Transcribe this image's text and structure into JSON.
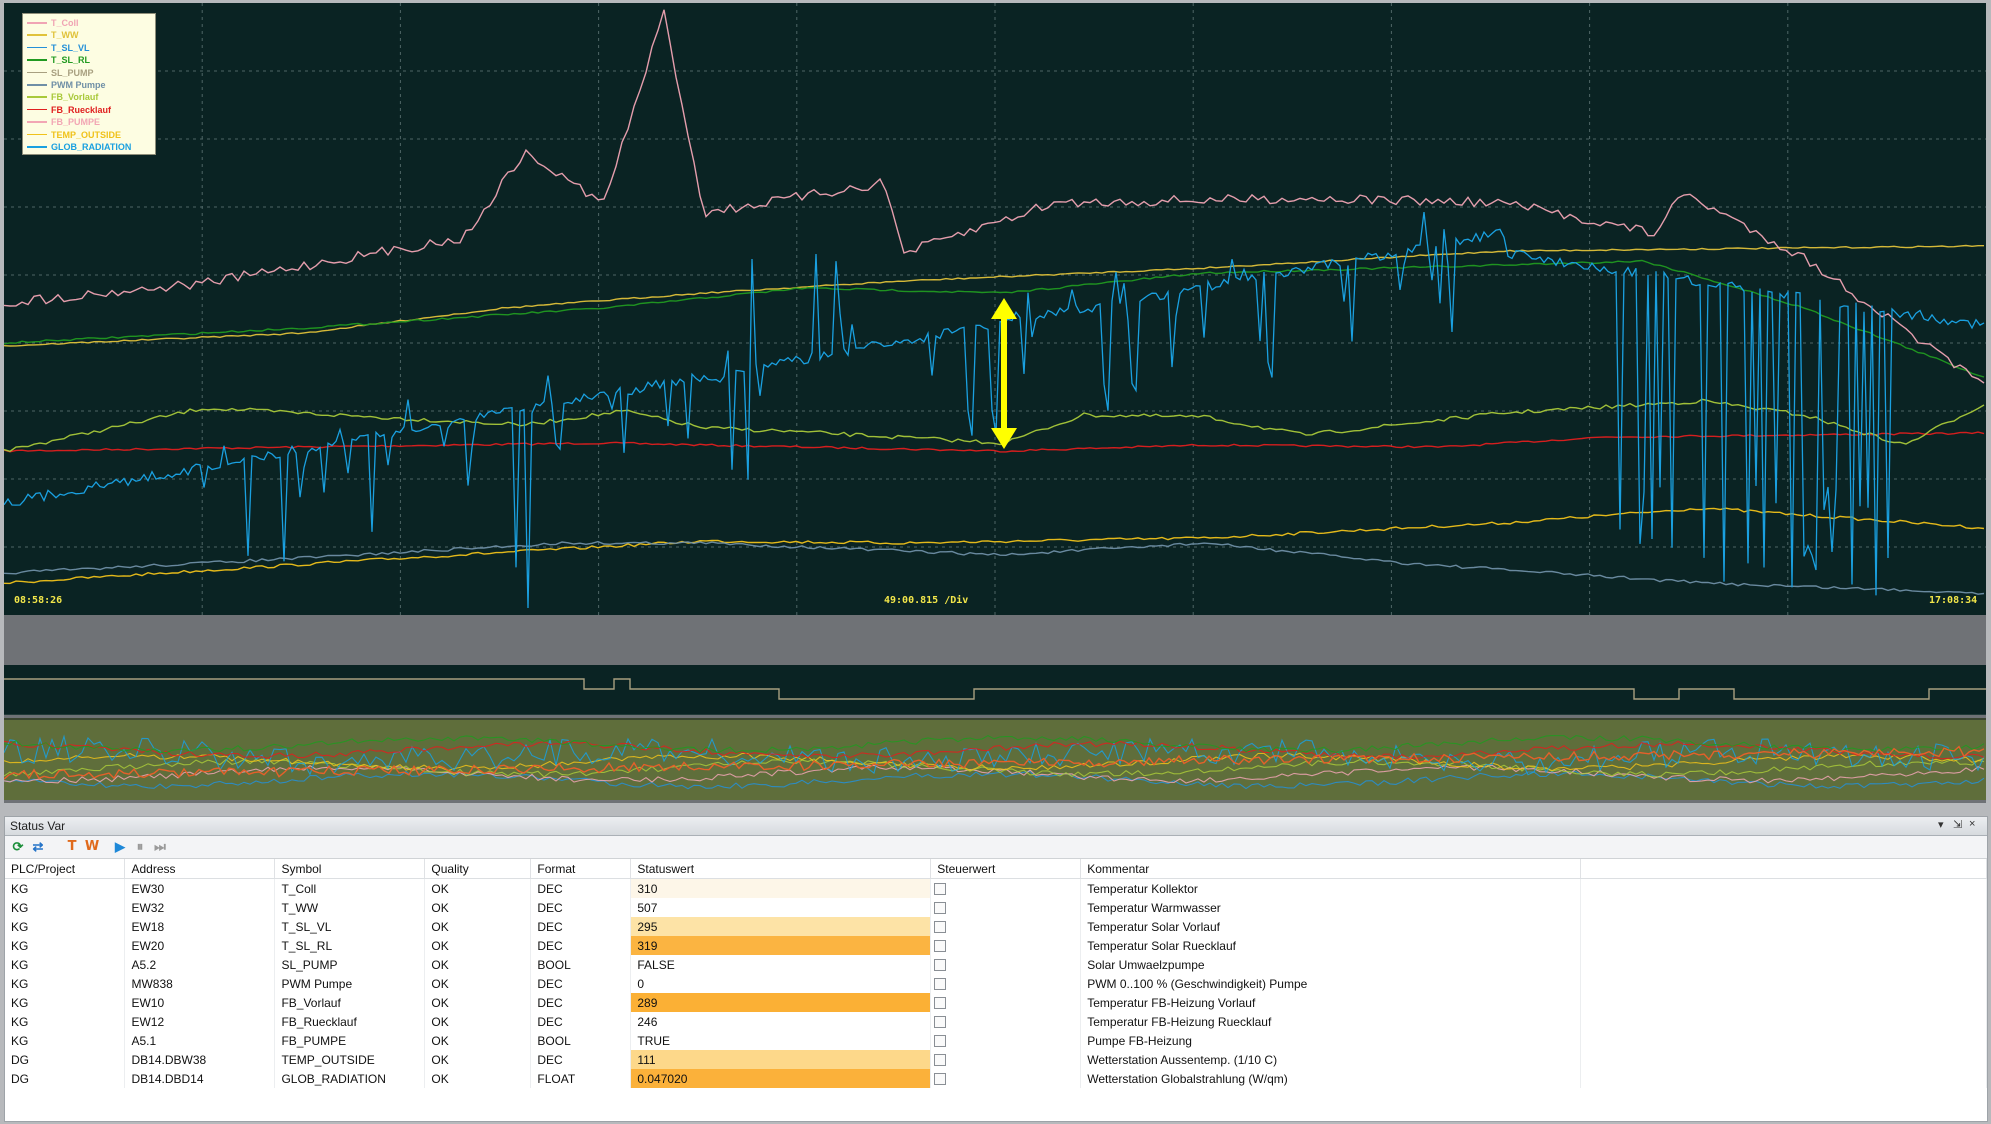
{
  "trend": {
    "start_time": "08:58:26",
    "end_time": "17:08:34",
    "division": "49:00.815 /Div",
    "legend": [
      {
        "name": "T_Coll",
        "color": "#f0a4b4"
      },
      {
        "name": "T_WW",
        "color": "#e0c23a"
      },
      {
        "name": "T_SL_VL",
        "color": "#2590d8"
      },
      {
        "name": "T_SL_RL",
        "color": "#219a21"
      },
      {
        "name": "SL_PUMP",
        "color": "#a8a080"
      },
      {
        "name": "PWM Pumpe",
        "color": "#6f8fa6"
      },
      {
        "name": "FB_Vorlauf",
        "color": "#a9c93a"
      },
      {
        "name": "FB_Ruecklauf",
        "color": "#e01f1f"
      },
      {
        "name": "FB_PUMPE",
        "color": "#f2a6b4"
      },
      {
        "name": "TEMP_OUTSIDE",
        "color": "#f0c21a"
      },
      {
        "name": "GLOB_RADIATION",
        "color": "#1aa0e0"
      }
    ],
    "marker_color": "#ffff00"
  },
  "status_panel": {
    "title": "Status Var",
    "controls": {
      "pin": "▾",
      "float": "⇲",
      "close": "×"
    },
    "columns": [
      "PLC/Project",
      "Address",
      "Symbol",
      "Quality",
      "Format",
      "Statuswert",
      "Steuerwert",
      "Kommentar"
    ],
    "rows": [
      {
        "plc": "KG",
        "address": "EW30",
        "symbol": "T_Coll",
        "quality": "OK",
        "format": "DEC",
        "value": "310",
        "comment": "Temperatur Kollektor",
        "highlight": "#fdf6e8"
      },
      {
        "plc": "KG",
        "address": "EW32",
        "symbol": "T_WW",
        "quality": "OK",
        "format": "DEC",
        "value": "507",
        "comment": "Temperatur Warmwasser",
        "highlight": ""
      },
      {
        "plc": "KG",
        "address": "EW18",
        "symbol": "T_SL_VL",
        "quality": "OK",
        "format": "DEC",
        "value": "295",
        "comment": "Temperatur Solar Vorlauf",
        "highlight": "#fde3a6"
      },
      {
        "plc": "KG",
        "address": "EW20",
        "symbol": "T_SL_RL",
        "quality": "OK",
        "format": "DEC",
        "value": "319",
        "comment": "Temperatur Solar Ruecklauf",
        "highlight": "#fbb441"
      },
      {
        "plc": "KG",
        "address": "A5.2",
        "symbol": "SL_PUMP",
        "quality": "OK",
        "format": "BOOL",
        "value": "FALSE",
        "comment": "Solar Umwaelzpumpe",
        "highlight": ""
      },
      {
        "plc": "KG",
        "address": "MW838",
        "symbol": "PWM Pumpe",
        "quality": "OK",
        "format": "DEC",
        "value": "0",
        "comment": "PWM 0..100 % (Geschwindigkeit) Pumpe",
        "highlight": ""
      },
      {
        "plc": "KG",
        "address": "EW10",
        "symbol": "FB_Vorlauf",
        "quality": "OK",
        "format": "DEC",
        "value": "289",
        "comment": "Temperatur FB-Heizung Vorlauf",
        "highlight": "#fbb035"
      },
      {
        "plc": "KG",
        "address": "EW12",
        "symbol": "FB_Ruecklauf",
        "quality": "OK",
        "format": "DEC",
        "value": "246",
        "comment": "Temperatur FB-Heizung Ruecklauf",
        "highlight": ""
      },
      {
        "plc": "KG",
        "address": "A5.1",
        "symbol": "FB_PUMPE",
        "quality": "OK",
        "format": "BOOL",
        "value": "TRUE",
        "comment": "Pumpe FB-Heizung",
        "highlight": ""
      },
      {
        "plc": "DG",
        "address": "DB14.DBW38",
        "symbol": "TEMP_OUTSIDE",
        "quality": "OK",
        "format": "DEC",
        "value": "111",
        "comment": "Wetterstation Aussentemp. (1/10 C)",
        "highlight": "#fdd88a"
      },
      {
        "plc": "DG",
        "address": "DB14.DBD14",
        "symbol": "GLOB_RADIATION",
        "quality": "OK",
        "format": "FLOAT",
        "value": "0.047020",
        "comment": "Wetterstation Globalstrahlung (W/qm)",
        "highlight": "#fbb13a"
      }
    ]
  }
}
